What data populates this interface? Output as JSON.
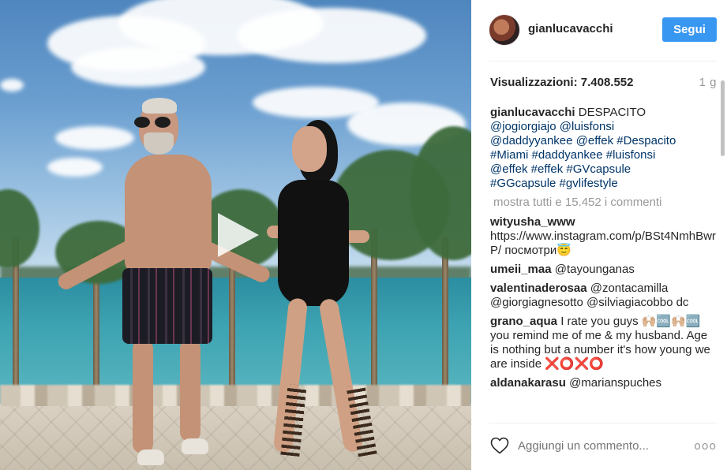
{
  "post": {
    "username": "gianlucavacchi",
    "follow_label": "Segui",
    "views_label": "Visualizzazioni:",
    "views_count": "7.408.552",
    "time_ago": "1 g",
    "caption": {
      "username": "gianlucavacchi",
      "text_1": "DESPACITO",
      "text_2": "@jogiorgiajo @luisfonsi",
      "text_3": "@daddyyankee @effek #Despacito",
      "text_4": "#Miami #daddyankee #luisfonsi",
      "text_5": "@effek #effek #GVcapsule",
      "text_6": "#GGcapsule #gvlifestyle"
    },
    "show_all_comments": "mostra tutti e 15.452 i commenti",
    "comments": [
      {
        "user": "wityusha_www",
        "text": "https://www.instagram.com/p/BSt4NmhBwrP/ посмотри😇"
      },
      {
        "user": "umeii_maa",
        "text": "@tayounganas"
      },
      {
        "user": "valentinaderosaa",
        "text": "@zontacamilla @giorgiagnesotto @silviagiacobbo dc"
      },
      {
        "user": "grano_aqua",
        "text": "I rate you guys 🙌🏼🆒🙌🏼🆒 you remind me of me & my husband. Age is nothing but a number it's how young we are inside ❌⭕❌⭕"
      },
      {
        "user": "aldanakarasu",
        "text": "@marianspuches"
      }
    ],
    "add_comment_placeholder": "Aggiungi un commento...",
    "more_label": "ooo"
  },
  "icons": {
    "play": "play-icon",
    "like": "heart-icon",
    "options": "more-options-icon"
  },
  "colors": {
    "follow_button": "#3897f0",
    "link": "#003569",
    "muted": "#999999"
  }
}
